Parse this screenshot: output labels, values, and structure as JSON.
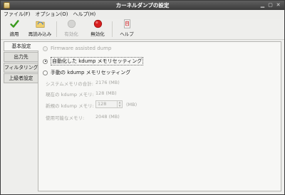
{
  "window": {
    "title": "カーネルダンプの設定"
  },
  "menubar": {
    "items": [
      "ファイル(F)",
      "オプション(O)",
      "ヘルプ(H)"
    ]
  },
  "toolbar": {
    "apply": "適用",
    "reload": "再読み込み",
    "enable": "有効化",
    "disable": "無効化",
    "help": "ヘルプ"
  },
  "tabs": [
    "基本設定",
    "出力先",
    "フィルタリング",
    "上級者設定"
  ],
  "basic": {
    "firmware_dump": "Firmware assisted dump",
    "auto_setting": "自動化した kdump メモリセッティング",
    "manual_setting": "手動の kdump メモリセッティング",
    "total_memory_label": "システムメモリの合計:",
    "total_memory_value": "2176 (MB)",
    "current_kdump_label": "現在の kdump メモリ:",
    "current_kdump_value": "128 (MB)",
    "new_kdump_label": "新規の kdump メモリ:",
    "new_kdump_value": "128",
    "new_kdump_unit": "(MB)",
    "usable_memory_label": "使用可能なメモリ:",
    "usable_memory_value": "2048 (MB)"
  }
}
